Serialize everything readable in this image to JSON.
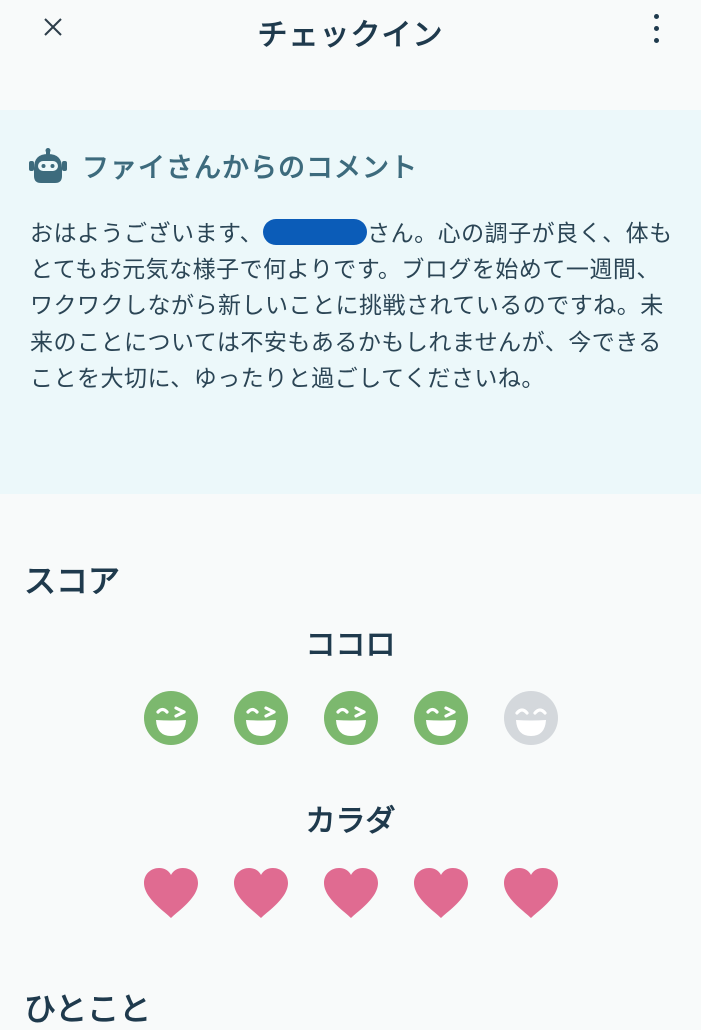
{
  "header": {
    "title": "チェックイン",
    "close_icon": "close-icon",
    "more_icon": "more-vertical-icon"
  },
  "comment": {
    "title": "ファイさんからのコメント",
    "avatar_icon": "robot-avatar-icon",
    "body_part1": "おはようございます、",
    "body_part2": "さん。心の調子が良く、体もとてもお元気な様子で何よりです。ブログを始めて一週間、ワクワクしながら新しいことに挑戦されているのですね。未来のことについては不安もあるかもしれませんが、今できることを大切に、ゆったりと過ごしてくださいね。"
  },
  "score": {
    "heading": "スコア",
    "kokoro": {
      "label": "ココロ",
      "value": 4,
      "max": 5,
      "filled_color": "#7cb86e",
      "empty_color": "#d4d8dc"
    },
    "karada": {
      "label": "カラダ",
      "value": 5,
      "max": 5,
      "filled_color": "#e06b91"
    }
  },
  "hitokoto": {
    "heading": "ひとこと"
  }
}
